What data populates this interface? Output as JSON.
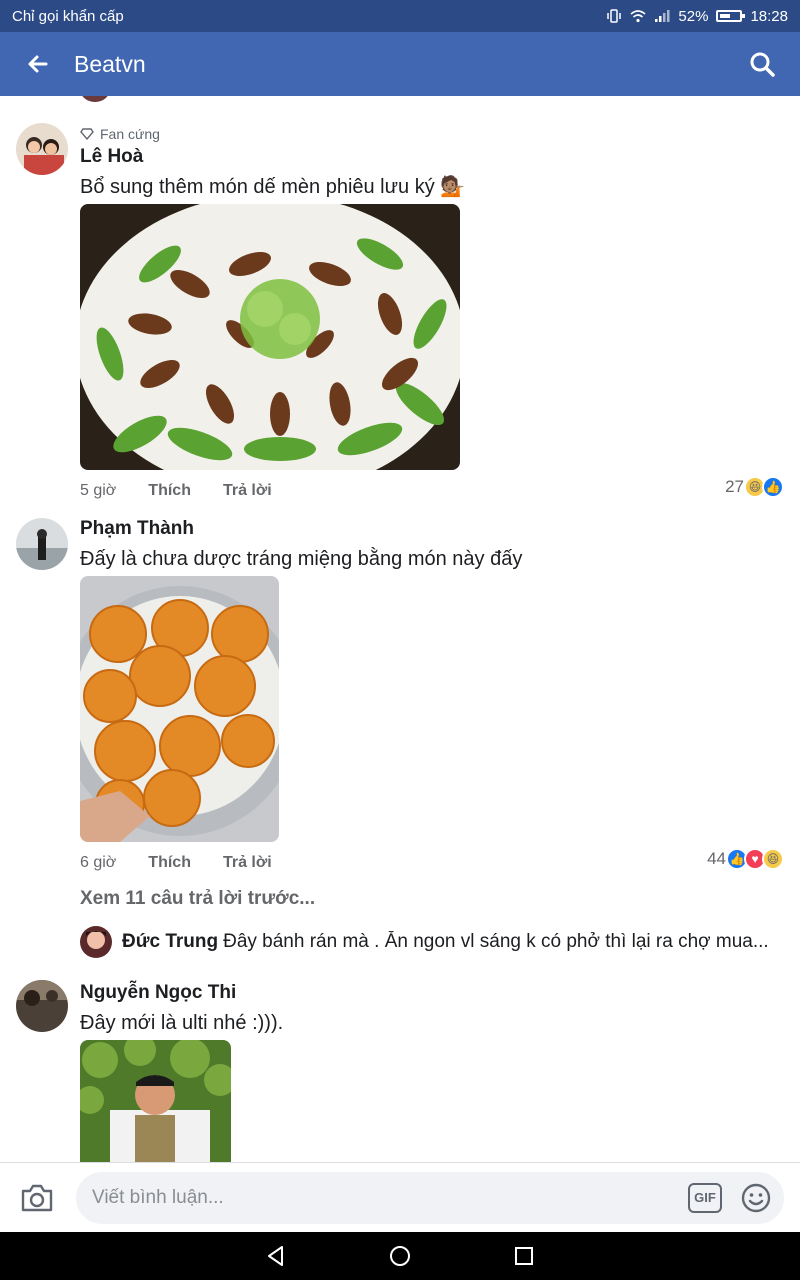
{
  "status_bar": {
    "carrier": "Chỉ gọi khẩn cấp",
    "battery": "52%",
    "time": "18:28"
  },
  "app_bar": {
    "title": "Beatvn",
    "back_icon": "arrow-left-icon",
    "search_icon": "search-icon"
  },
  "comments": [
    {
      "badge": "Fan cứng",
      "name": "Lê Hoà",
      "text": "Bổ sung thêm món dế mèn phiêu lưu ký 💁🏽",
      "time": "5 giờ",
      "like": "Thích",
      "reply": "Trả lời",
      "reaction_count": "27"
    },
    {
      "name": "Phạm Thành",
      "text": " Đấy là chưa dược tráng miệng bằng món này đấy",
      "time": "6 giờ",
      "like": "Thích",
      "reply": "Trả lời",
      "reaction_count": "44",
      "view_more": "Xem 11 câu trả lời trước...",
      "latest_reply": {
        "name": "Đức Trung",
        "text": "Đây bánh rán mà . Ăn ngon vl sáng k có phở thì lại ra chợ mua..."
      }
    },
    {
      "name": "Nguyễn Ngọc Thi",
      "text": "Đây mới là ulti nhé :)))."
    }
  ],
  "composer": {
    "placeholder": "Viết bình luận...",
    "gif_label": "GIF",
    "camera_icon": "camera-icon",
    "emoji_icon": "emoji-icon"
  },
  "nav_bar": {
    "back_icon": "nav-back-icon",
    "home_icon": "nav-home-icon",
    "recents_icon": "nav-recents-icon"
  }
}
